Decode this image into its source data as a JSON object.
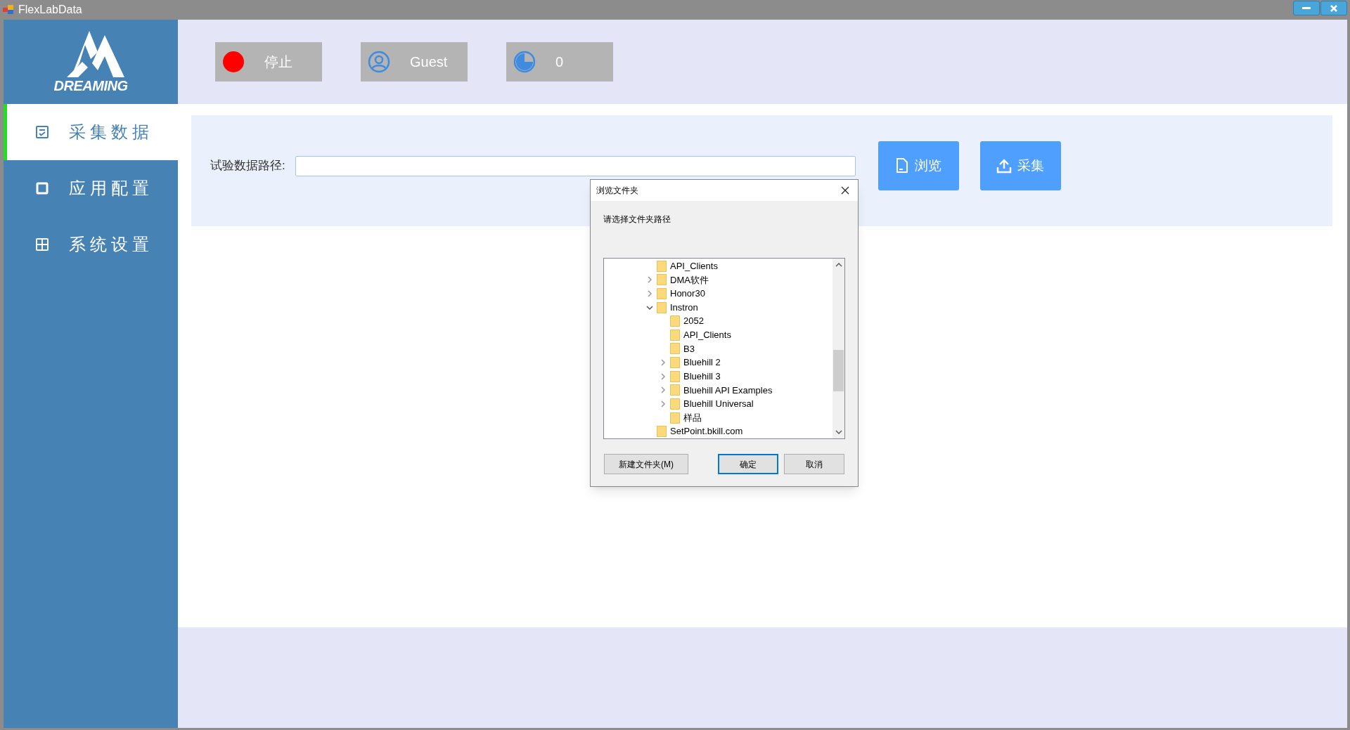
{
  "window": {
    "title": "FlexLabData"
  },
  "logo": {
    "text": "DREAMING"
  },
  "sidebar": {
    "items": [
      {
        "label": "采集数据",
        "selected": true,
        "kind": "checklist"
      },
      {
        "label": "应用配置",
        "selected": false,
        "kind": "square"
      },
      {
        "label": "系统设置",
        "selected": false,
        "kind": "grid"
      }
    ]
  },
  "status_buttons": [
    {
      "kind": "stop",
      "label": "停止"
    },
    {
      "kind": "user",
      "label": "Guest"
    },
    {
      "kind": "pie",
      "label": "0"
    }
  ],
  "path_form": {
    "label": "试验数据路径:",
    "buttons": [
      {
        "kind": "browse",
        "label": "浏览"
      },
      {
        "kind": "upload",
        "label": "采集"
      }
    ]
  },
  "dialog": {
    "title": "浏览文件夹",
    "prompt": "请选择文件夹路径",
    "tree": [
      {
        "label": "API_Clients"
      },
      {
        "label": "DMA软件",
        "expanded": false
      },
      {
        "label": "Honor30",
        "expanded": false
      },
      {
        "label": "Instron",
        "expanded": true,
        "children": [
          {
            "label": "2052"
          },
          {
            "label": "API_Clients"
          },
          {
            "label": "B3"
          },
          {
            "label": "Bluehill 2",
            "expanded": false
          },
          {
            "label": "Bluehill 3",
            "expanded": false
          },
          {
            "label": "Bluehill API Examples",
            "expanded": false
          },
          {
            "label": "Bluehill Universal",
            "expanded": false
          },
          {
            "label": "样品"
          }
        ]
      },
      {
        "label": "SetPoint.bkill.com"
      }
    ],
    "buttons": [
      {
        "label": "新建文件夹(M)",
        "selected": false
      },
      {
        "label": "确定",
        "selected": true
      },
      {
        "label": "取消",
        "selected": false
      }
    ]
  }
}
